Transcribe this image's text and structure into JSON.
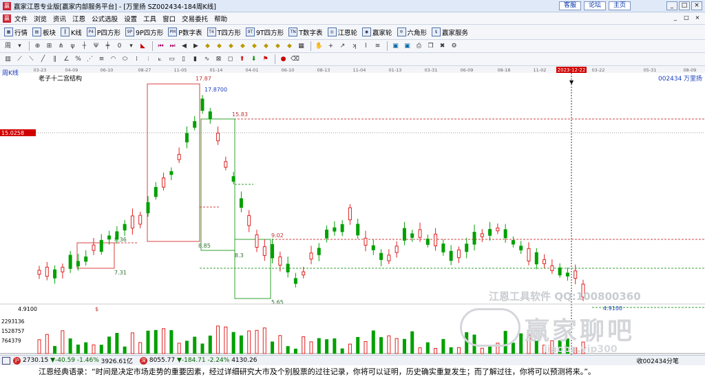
{
  "window": {
    "title": "赢家江恩专业版[赢家内部服务平台] - [万里扬  SZ002434-184周K线]",
    "links": [
      "客服",
      "论坛",
      "主页"
    ],
    "win_buttons": [
      "_",
      "□",
      "×"
    ]
  },
  "menu": {
    "items": [
      "文件",
      "浏览",
      "资讯",
      "江恩",
      "公式选股",
      "设置",
      "工具",
      "窗口",
      "交易委托",
      "帮助"
    ],
    "mdi_buttons": [
      "_",
      "□",
      "×"
    ]
  },
  "toolbar_main": [
    {
      "icon": "grid-icon",
      "glyph": "▦",
      "label": "行情"
    },
    {
      "icon": "blocks-icon",
      "glyph": "▤",
      "label": "板块"
    },
    {
      "icon": "kline-icon",
      "glyph": "┃",
      "label": "K线"
    },
    {
      "icon": "p-square-icon",
      "glyph": "P4",
      "label": "P四方形"
    },
    {
      "icon": "9p-square-icon",
      "glyph": "9P",
      "label": "9P四方形"
    },
    {
      "icon": "pm-table-icon",
      "glyph": "PM",
      "label": "P数字表"
    },
    {
      "icon": "t-square-icon",
      "glyph": "T4",
      "label": "T四方形"
    },
    {
      "icon": "9t-square-icon",
      "glyph": "9T",
      "label": "9T四方形"
    },
    {
      "icon": "tn-table-icon",
      "glyph": "TN",
      "label": "T数字表"
    },
    {
      "icon": "gann-wheel-icon",
      "glyph": "◎",
      "label": "江恩轮"
    },
    {
      "icon": "winner-wheel-icon",
      "glyph": "◉",
      "label": "赢家轮"
    },
    {
      "icon": "hexagon-icon",
      "glyph": "✡",
      "label": "六角形"
    },
    {
      "icon": "service-icon",
      "glyph": "$",
      "label": "赢家服务"
    }
  ],
  "period": {
    "label": "周"
  },
  "chart": {
    "period_label": "周K线",
    "indicator_label": "老子十二宫结构",
    "stock_code": "002434",
    "stock_name": "万里扬",
    "cursor_date": "2023-12-22",
    "cursor_price": "15.0258",
    "date_ticks": [
      "03-23",
      "04-09",
      "06-10",
      "08-27",
      "11-05",
      "01-14",
      "04-01",
      "06-10",
      "08-13",
      "11-04",
      "01-13",
      "03-31",
      "06-09",
      "08-18",
      "11-02",
      "03-22",
      "05-31",
      "08-09"
    ],
    "price_labels": {
      "high": "17.87",
      "high_exact": "17.8700",
      "level_1583": "15.83",
      "level_902": "9.02",
      "level_885": "8.85",
      "level_836": "8.36",
      "level_83": "8.3",
      "level_731": "7.31",
      "level_565": "5.65",
      "low_exact": "4.9100",
      "axis_low": "4.9100"
    },
    "volume_axis": [
      "2293136",
      "1528757",
      "764379"
    ],
    "colors": {
      "up": "#e02020",
      "down": "#00a000",
      "box_red": "#d84040",
      "box_green": "#30a030",
      "cursor_badge": "#d00000",
      "code_blue": "#1a3fbf"
    }
  },
  "status": {
    "sh_index": "2730.15",
    "sh_change": "▼-40.59",
    "sh_pct": "-1.46%",
    "sh_amount": "3926.61亿",
    "sz_index": "8055.77",
    "sz_change": "▼-184.71",
    "sz_pct": "-2.24%",
    "sz_amount": "4130.26",
    "right_text": "收002434分笔"
  },
  "quote": "江恩经典语录：“时间是决定市场走势的重要因素，经过详细研究大市及个别股票的过往记录，你将可以证明，历史确实重复发生；而了解过往，你将可以预测将来。”。",
  "watermark": {
    "line1": "江恩工具软件  QQ:100800360",
    "line2": "赢家聊吧",
    "line3": "liaoba.vip300"
  }
}
